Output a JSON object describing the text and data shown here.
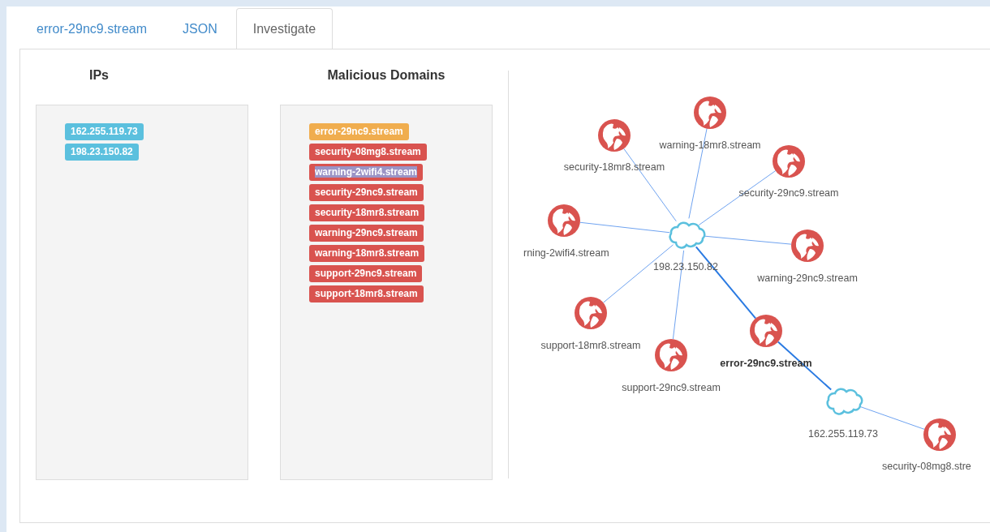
{
  "tabs": [
    {
      "label": "error-29nc9.stream",
      "selected": false
    },
    {
      "label": "JSON",
      "selected": false
    },
    {
      "label": "Investigate",
      "selected": true
    }
  ],
  "ips": {
    "title": "IPs",
    "items": [
      {
        "label": "162.255.119.73",
        "color": "#5bc0de",
        "highlighted": false
      },
      {
        "label": "198.23.150.82",
        "color": "#5bc0de",
        "highlighted": false
      }
    ]
  },
  "domains": {
    "title": "Malicious Domains",
    "items": [
      {
        "label": "error-29nc9.stream",
        "color": "#f0ad4e",
        "highlighted": false
      },
      {
        "label": "security-08mg8.stream",
        "color": "#d9534f",
        "highlighted": false
      },
      {
        "label": "warning-2wifi4.stream",
        "color": "#d9534f",
        "highlighted": true
      },
      {
        "label": "security-29nc9.stream",
        "color": "#d9534f",
        "highlighted": false
      },
      {
        "label": "security-18mr8.stream",
        "color": "#d9534f",
        "highlighted": false
      },
      {
        "label": "warning-29nc9.stream",
        "color": "#d9534f",
        "highlighted": false
      },
      {
        "label": "warning-18mr8.stream",
        "color": "#d9534f",
        "highlighted": false
      },
      {
        "label": "support-29nc9.stream",
        "color": "#d9534f",
        "highlighted": false
      },
      {
        "label": "support-18mr8.stream",
        "color": "#d9534f",
        "highlighted": false
      }
    ]
  },
  "graph": {
    "nodes": [
      {
        "kind": "ip",
        "label": "198.23.150.82",
        "selected": false
      },
      {
        "kind": "ip",
        "label": "162.255.119.73",
        "selected": false
      },
      {
        "kind": "domain",
        "label": "warning-18mr8.stream",
        "selected": false
      },
      {
        "kind": "domain",
        "label": "security-18mr8.stream",
        "selected": false
      },
      {
        "kind": "domain",
        "label": "security-29nc9.stream",
        "selected": false
      },
      {
        "kind": "domain",
        "label": "rning-2wifi4.stream",
        "selected": false
      },
      {
        "kind": "domain",
        "label": "warning-29nc9.stream",
        "selected": false
      },
      {
        "kind": "domain",
        "label": "support-18mr8.stream",
        "selected": false
      },
      {
        "kind": "domain",
        "label": "support-29nc9.stream",
        "selected": false
      },
      {
        "kind": "domain",
        "label": "error-29nc9.stream",
        "selected": true
      },
      {
        "kind": "domain",
        "label": "security-08mg8.stre",
        "selected": false
      }
    ],
    "edges": [
      {
        "highlighted": false
      },
      {
        "highlighted": false
      },
      {
        "highlighted": false
      },
      {
        "highlighted": false
      },
      {
        "highlighted": false
      },
      {
        "highlighted": false
      },
      {
        "highlighted": false
      },
      {
        "highlighted": true
      },
      {
        "highlighted": true
      },
      {
        "highlighted": false
      }
    ]
  }
}
